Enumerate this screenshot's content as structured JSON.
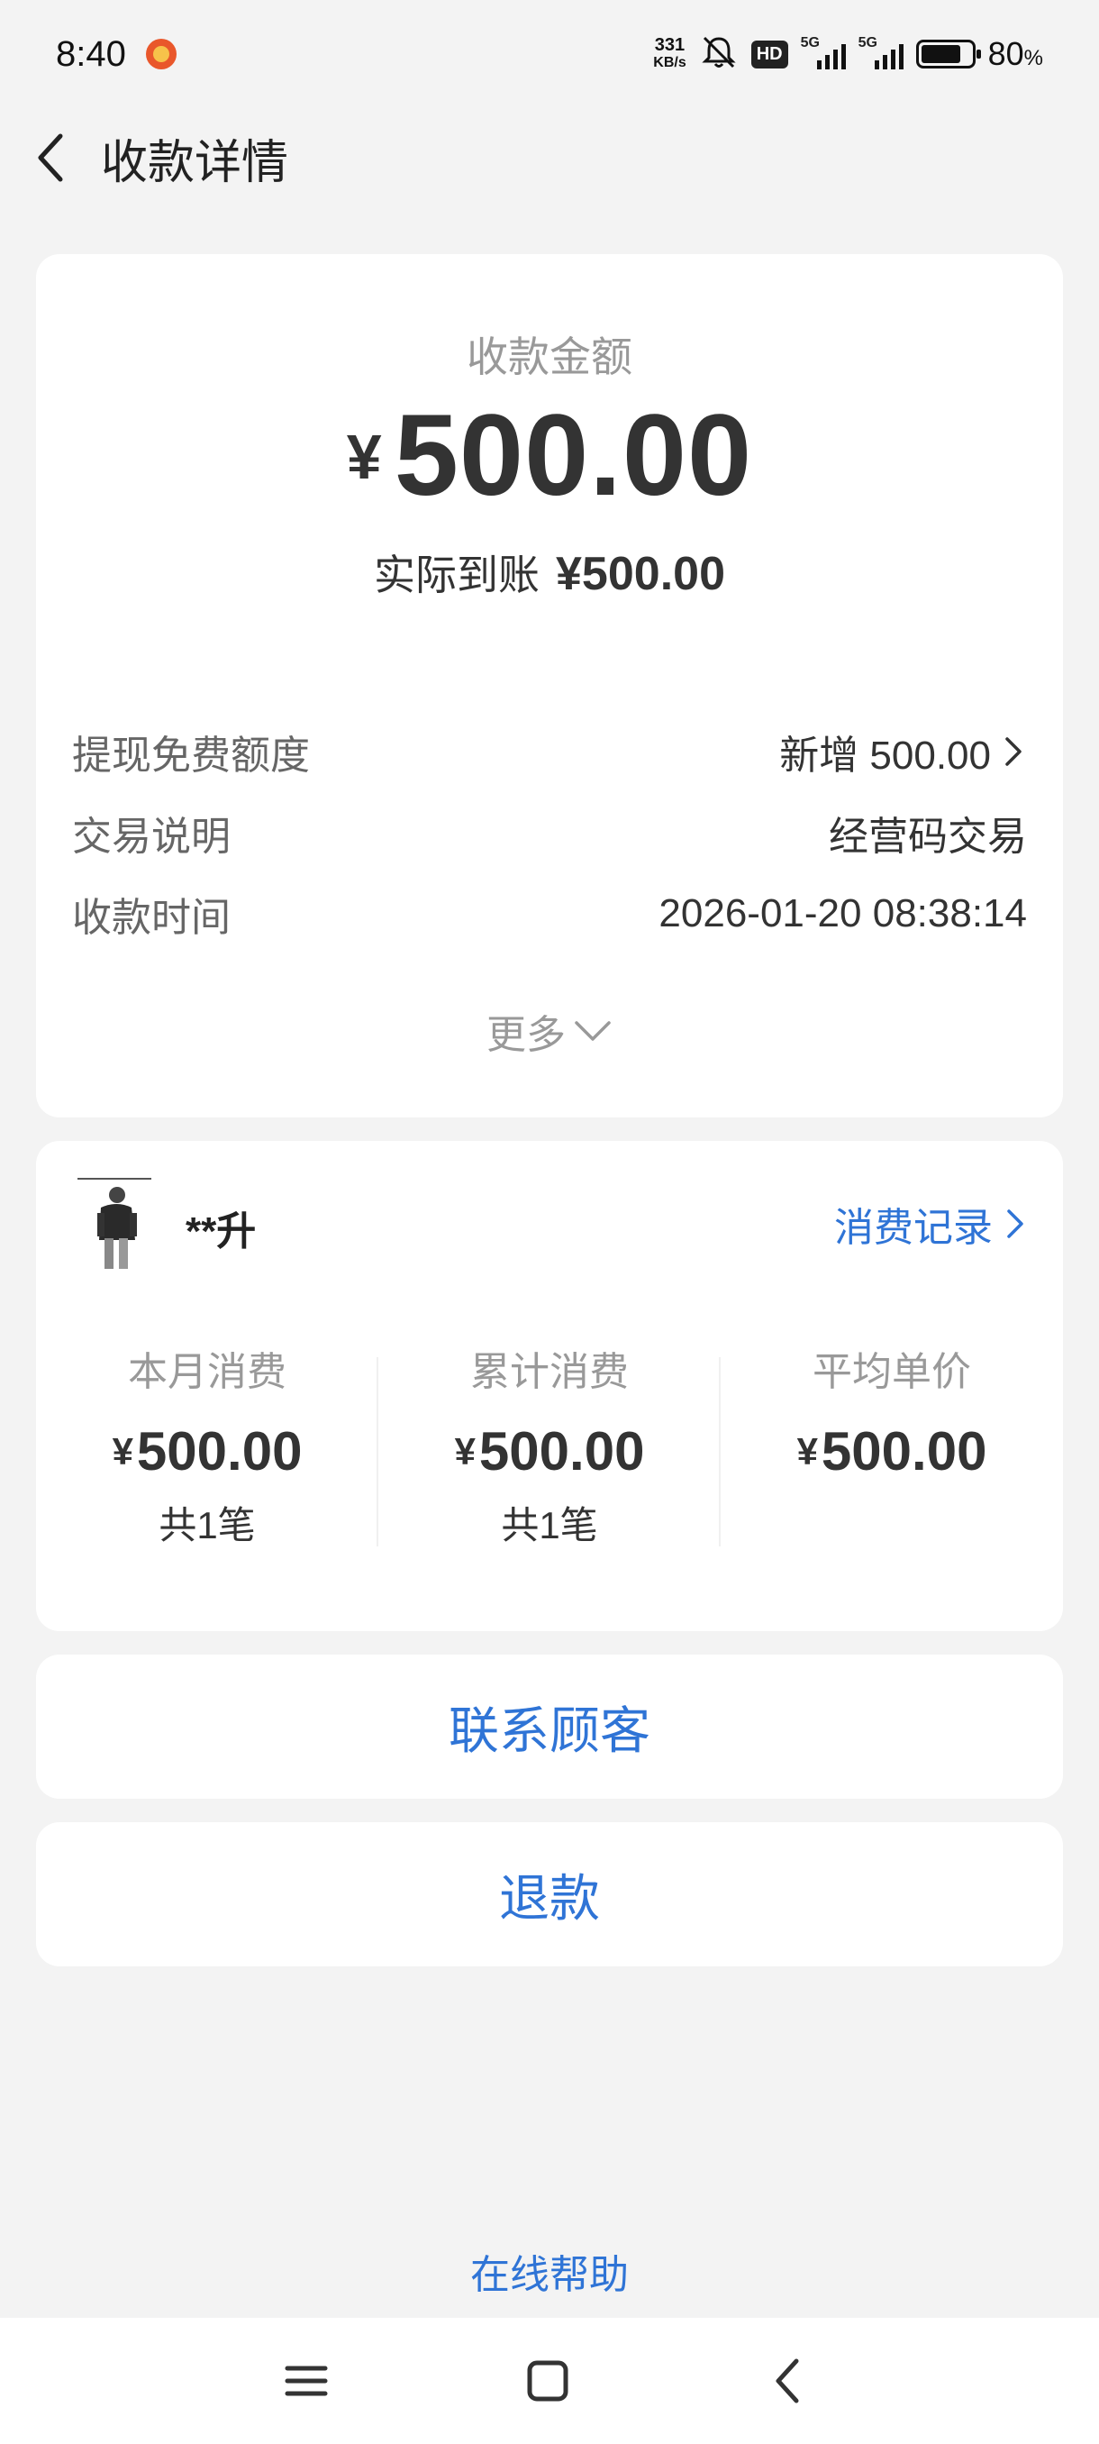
{
  "status_bar": {
    "time": "8:40",
    "net_speed_value": "331",
    "net_speed_unit": "KB/s",
    "hd_badge": "HD",
    "signal1_label": "5G",
    "signal2_label": "5G",
    "battery_percent": "80",
    "battery_unit": "%",
    "battery_level": 0.8
  },
  "header": {
    "title": "收款详情",
    "back_icon": "chevron-left-icon"
  },
  "amount_card": {
    "label": "收款金额",
    "currency": "¥",
    "amount": "500.00",
    "actual_label": "实际到账",
    "actual_value": "¥500.00",
    "rows": [
      {
        "key": "提现免费额度",
        "value": "新增 500.00"
      },
      {
        "key": "交易说明",
        "value": "经营码交易"
      },
      {
        "key": "收款时间",
        "value": "2026-01-20 08:38:14"
      }
    ],
    "more_label": "更多"
  },
  "customer_card": {
    "name": "**升",
    "record_link": "消费记录",
    "stats": [
      {
        "title": "本月消费",
        "currency": "¥",
        "amount": "500.00",
        "count": "共1笔"
      },
      {
        "title": "累计消费",
        "currency": "¥",
        "amount": "500.00",
        "count": "共1笔"
      },
      {
        "title": "平均单价",
        "currency": "¥",
        "amount": "500.00",
        "count": ""
      }
    ]
  },
  "actions": {
    "contact": "联系顾客",
    "refund": "退款"
  },
  "footer": {
    "help": "在线帮助"
  },
  "colors": {
    "link_blue": "#2f74d6",
    "page_bg": "#f3f3f3",
    "card_bg": "#ffffff"
  }
}
